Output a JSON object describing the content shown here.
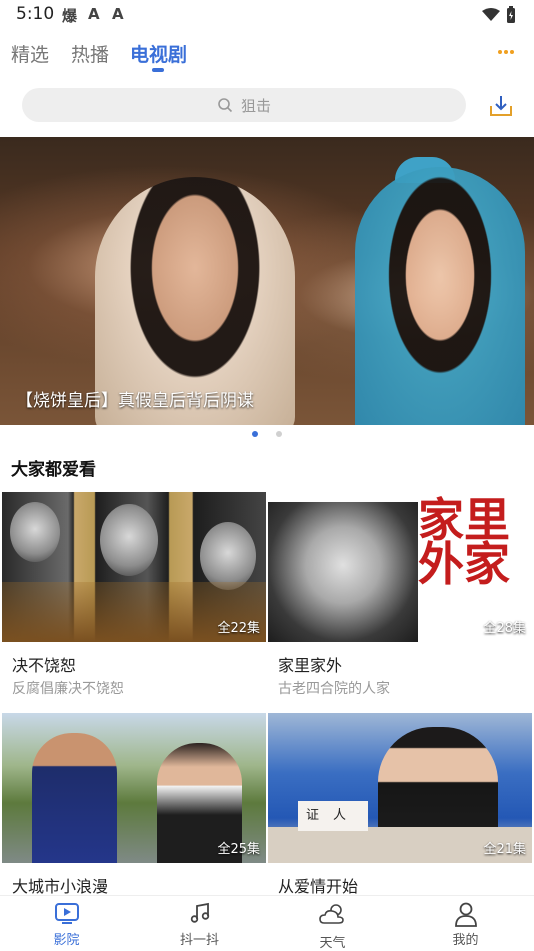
{
  "status_bar": {
    "time": "5:10",
    "notifications": [
      "爆",
      "A",
      "A"
    ]
  },
  "top_tabs": [
    {
      "label": "精选",
      "active": false
    },
    {
      "label": "热播",
      "active": false
    },
    {
      "label": "电视剧",
      "active": true
    }
  ],
  "search": {
    "placeholder": "狙击"
  },
  "banner": {
    "caption": "【烧饼皇后】真假皇后背后阴谋",
    "page_count": 2,
    "active_index": 0
  },
  "section": {
    "title": "大家都爱看",
    "items": [
      {
        "title": "决不饶恕",
        "subtitle": "反腐倡廉决不饶恕",
        "episodes": "全22集"
      },
      {
        "title": "家里家外",
        "subtitle": "古老四合院的人家",
        "episodes": "全28集",
        "thumb_text": "家里外家"
      },
      {
        "title": "大城市小浪漫",
        "subtitle": "",
        "episodes": "全25集"
      },
      {
        "title": "从爱情开始",
        "subtitle": "",
        "episodes": "全21集",
        "thumb_text": "证人"
      }
    ]
  },
  "bottom_nav": [
    {
      "label": "影院",
      "icon": "play-icon",
      "active": true
    },
    {
      "label": "抖一抖",
      "icon": "music-note-icon",
      "active": false
    },
    {
      "label": "天气",
      "icon": "weather-icon",
      "active": false
    },
    {
      "label": "我的",
      "icon": "user-icon",
      "active": false
    }
  ],
  "colors": {
    "accent": "#3a6fd8",
    "more_dots": "#f0a020"
  }
}
